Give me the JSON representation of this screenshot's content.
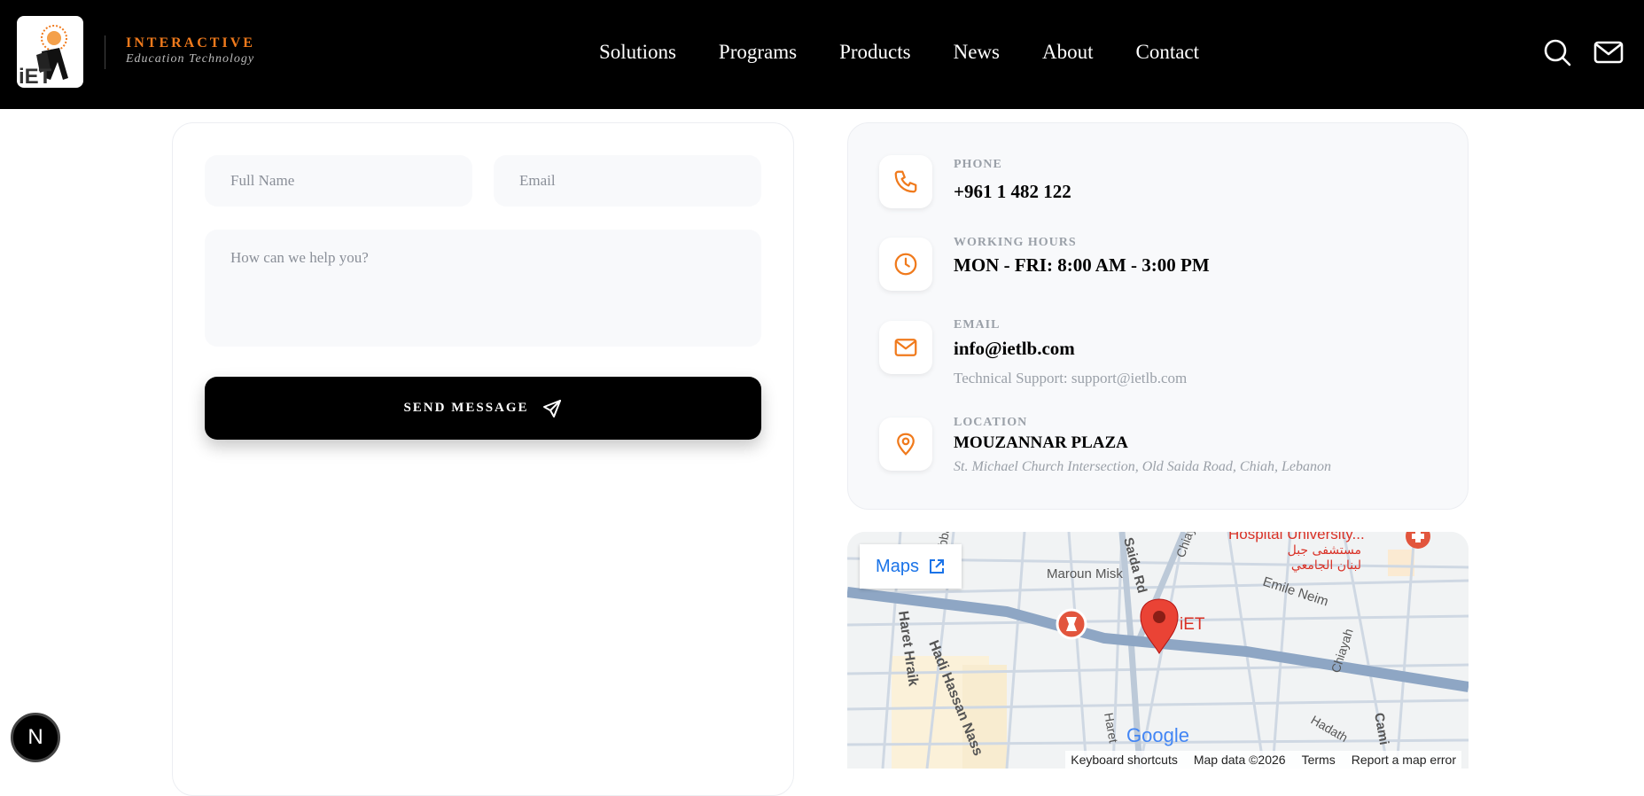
{
  "header": {
    "brand_line1": "INTERACTIVE",
    "brand_line2": "Education Technology",
    "logo_text": "iET",
    "nav": [
      "Solutions",
      "Programs",
      "Products",
      "News",
      "About",
      "Contact"
    ]
  },
  "form": {
    "name_placeholder": "Full Name",
    "email_placeholder": "Email",
    "message_placeholder": "How can we help you?",
    "send_label": "SEND MESSAGE"
  },
  "contact": {
    "phone_label": "PHONE",
    "phone_value": "+961 1 482 122",
    "hours_label": "WORKING HOURS",
    "hours_value": "MON - FRI: 8:00 AM - 3:00 PM",
    "email_label": "EMAIL",
    "email_value": "info@ietlb.com",
    "support_text": "Technical Support: support@ietlb.com",
    "location_label": "LOCATION",
    "location_value": "MOUZANNAR PLAZA",
    "location_address": "St. Michael Church Intersection, Old Saida Road, Chiah, Lebanon"
  },
  "map": {
    "badge_label": "Maps",
    "marker_label": "iET",
    "streets": [
      "Maroun Misk",
      "Saida Rd",
      "Emile Neim",
      "Haret Hraik",
      "Hadi Hassan Nass",
      "Chiayah",
      "Hadath",
      "Cami",
      "Abbas El",
      "Chiay",
      "Haret"
    ],
    "poi_label": "Hospital University...",
    "poi_arabic_1": "مستشفى جبل",
    "poi_arabic_2": "لبنان الجامعي",
    "google_logo": "Google",
    "footer": [
      "Keyboard shortcuts",
      "Map data ©2026",
      "Terms",
      "Report a map error"
    ]
  },
  "next_badge": "N",
  "colors": {
    "accent": "#f07a1c",
    "primary": "#000000",
    "field_bg": "#f8f9fb"
  }
}
